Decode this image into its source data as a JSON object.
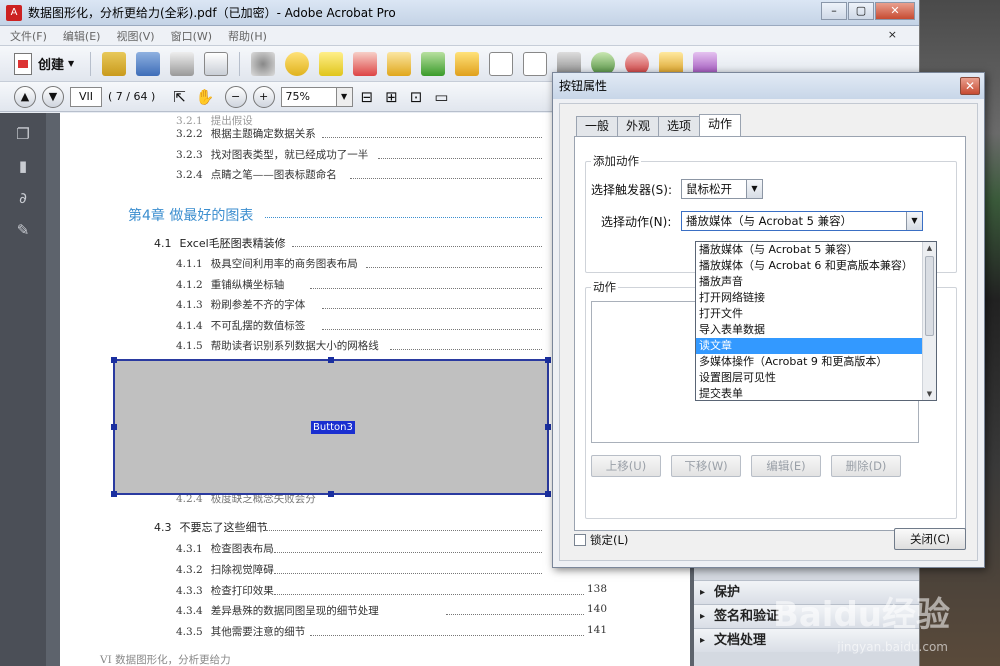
{
  "window": {
    "title": "数据图形化，分析更给力(全彩).pdf（已加密）- Adobe Acrobat Pro",
    "controls": [
      "–",
      "▢",
      "✕"
    ]
  },
  "menu": [
    "文件(F)",
    "编辑(E)",
    "视图(V)",
    "窗口(W)",
    "帮助(H)"
  ],
  "menu_close": "×",
  "toolbar": {
    "create_label": "创建"
  },
  "nav": {
    "page_label": "VII",
    "page_count": "( 7 / 64 )",
    "zoom": "75%"
  },
  "toc": {
    "top_items": [
      {
        "num": "3.2.1",
        "text": "提出假设"
      },
      {
        "num": "3.2.2",
        "text": "根据主题确定数据关系"
      },
      {
        "num": "3.2.3",
        "text": "找对图表类型，就已经成功了一半"
      },
      {
        "num": "3.2.4",
        "text": "点睛之笔——图表标题命名"
      }
    ],
    "chapter": "第4章  做最好的图表",
    "section_41": {
      "num": "4.1",
      "text": "Excel毛胚图表精装修"
    },
    "items_41": [
      {
        "num": "4.1.1",
        "text": "极具空间利用率的商务图表布局"
      },
      {
        "num": "4.1.2",
        "text": "重铺纵横坐标轴"
      },
      {
        "num": "4.1.3",
        "text": "粉刷参差不齐的字体"
      },
      {
        "num": "4.1.4",
        "text": "不可乱摆的数值标签"
      },
      {
        "num": "4.1.5",
        "text": "帮助读者识别系列数据大小的网格线"
      }
    ],
    "item_424": {
      "num": "4.2.4",
      "text": "极度缺乏概念失败会分"
    },
    "section_43": {
      "num": "4.3",
      "text": "不要忘了这些细节"
    },
    "items_43": [
      {
        "num": "4.3.1",
        "text": "检查图表布局",
        "page": ""
      },
      {
        "num": "4.3.2",
        "text": "扫除视觉障碍",
        "page": ""
      },
      {
        "num": "4.3.3",
        "text": "检查打印效果",
        "page": "138"
      },
      {
        "num": "4.3.4",
        "text": "差异悬殊的数据同图呈现的细节处理",
        "page": "140"
      },
      {
        "num": "4.3.5",
        "text": "其他需要注意的细节",
        "page": "141"
      }
    ],
    "footer": "VI    数据图形化，分析更给力"
  },
  "button_field": {
    "label": "Button3"
  },
  "right_pane": [
    "保护",
    "签名和验证",
    "文档处理"
  ],
  "dialog": {
    "title": "按钮属性",
    "close": "✕",
    "tabs": [
      "一般",
      "外观",
      "选项",
      "动作"
    ],
    "active_tab": "动作",
    "add_action_group": "添加动作",
    "trigger_label": "选择触发器(S):",
    "trigger_value": "鼠标松开",
    "action_label": "选择动作(N):",
    "action_value": "播放媒体（与 Acrobat 5 兼容）",
    "action_options": [
      "播放媒体（与 Acrobat 5 兼容）",
      "播放媒体（与 Acrobat 6 和更高版本兼容）",
      "播放声音",
      "打开网络链接",
      "打开文件",
      "导入表单数据",
      "读文章",
      "多媒体操作（Acrobat 9 和更高版本）",
      "设置图层可见性",
      "提交表单"
    ],
    "selected_option": "读文章",
    "actions_group": "动作",
    "buttons": [
      "上移(U)",
      "下移(W)",
      "编辑(E)",
      "删除(D)"
    ],
    "lock_label": "锁定(L)",
    "close_label": "关闭(C)"
  },
  "watermark": {
    "main": "Baidu经验",
    "sub": "jingyan.baidu.com"
  }
}
